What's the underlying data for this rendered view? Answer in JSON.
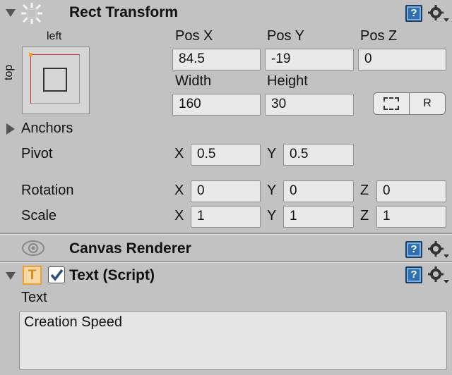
{
  "rect_transform": {
    "title": "Rect Transform",
    "anchor_preset": {
      "left_label": "left",
      "top_label": "top"
    },
    "pos_x": {
      "label": "Pos X",
      "value": "84.5"
    },
    "pos_y": {
      "label": "Pos Y",
      "value": "-19"
    },
    "pos_z": {
      "label": "Pos Z",
      "value": "0"
    },
    "width": {
      "label": "Width",
      "value": "160"
    },
    "height": {
      "label": "Height",
      "value": "30"
    },
    "raw_edit_button": "R",
    "anchors_label": "Anchors",
    "pivot": {
      "label": "Pivot",
      "x_label": "X",
      "x": "0.5",
      "y_label": "Y",
      "y": "0.5"
    },
    "rotation": {
      "label": "Rotation",
      "x_label": "X",
      "x": "0",
      "y_label": "Y",
      "y": "0",
      "z_label": "Z",
      "z": "0"
    },
    "scale": {
      "label": "Scale",
      "x_label": "X",
      "x": "1",
      "y_label": "Y",
      "y": "1",
      "z_label": "Z",
      "z": "1"
    }
  },
  "canvas_renderer": {
    "title": "Canvas Renderer"
  },
  "text_script": {
    "title": "Text (Script)",
    "icon_letter": "T",
    "enabled": true,
    "text_label": "Text",
    "text_value": "Creation Speed"
  },
  "colors": {
    "panel_bg": "#c2c2c2",
    "field_bg": "#e9e9e9",
    "help_blue": "#2f6fb0",
    "accent_orange": "#f0a030",
    "anchor_red": "#d03030"
  }
}
